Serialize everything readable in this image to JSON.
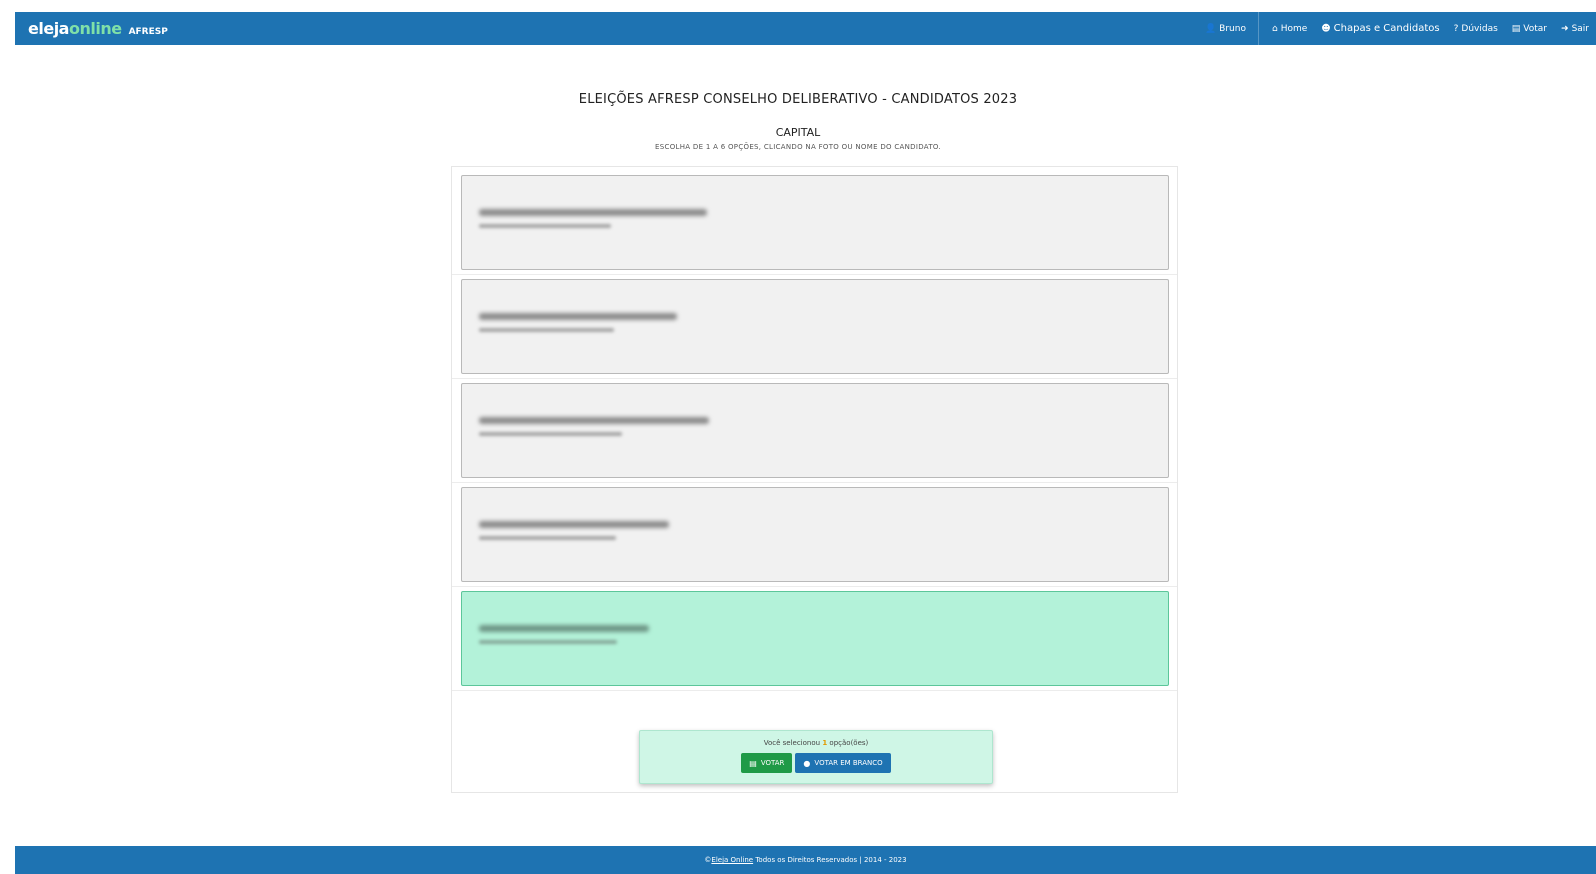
{
  "header": {
    "brand_main": "eleja",
    "brand_accent": "online",
    "brand_sub": "AFRESP",
    "nav": {
      "user": "Bruno",
      "home": "Home",
      "chapas": "Chapas e Candidatos",
      "duvidas": "Dúvidas",
      "votar": "Votar",
      "sair": "Sair"
    },
    "icons": {
      "user": "user-icon",
      "home": "home-icon",
      "chapas": "users-icon",
      "duvidas": "question-icon",
      "votar": "ballot-icon",
      "sair": "sign-out-icon"
    },
    "colors": {
      "bar": "#1e73b2",
      "accent": "#7fe0a8"
    }
  },
  "page": {
    "title": "ELEIÇÕES AFRESP CONSELHO DELIBERATIVO - CANDIDATOS 2023",
    "subtitle": "CAPITAL",
    "instructions": "ESCOLHA DE 1 A 6 OPÇÕES, CLICANDO NA FOTO OU NOME DO CANDIDATO."
  },
  "candidates": [
    {
      "selected": false
    },
    {
      "selected": false
    },
    {
      "selected": false
    },
    {
      "selected": false
    },
    {
      "selected": true
    }
  ],
  "vote_panel": {
    "message_prefix": "Você selecionou",
    "count": "1",
    "message_suffix": "opção(ões)",
    "votar_label": "VOTAR",
    "branco_label": "VOTAR EM BRANCO",
    "colors": {
      "votar": "#1f9a47",
      "branco": "#1e73b2",
      "selected_card": "#b3f2d9"
    }
  },
  "footer": {
    "copyright_symbol": "©",
    "link_text": "Eleja Online",
    "rest": "Todos os Direitos Reservados | 2014 - 2023"
  }
}
